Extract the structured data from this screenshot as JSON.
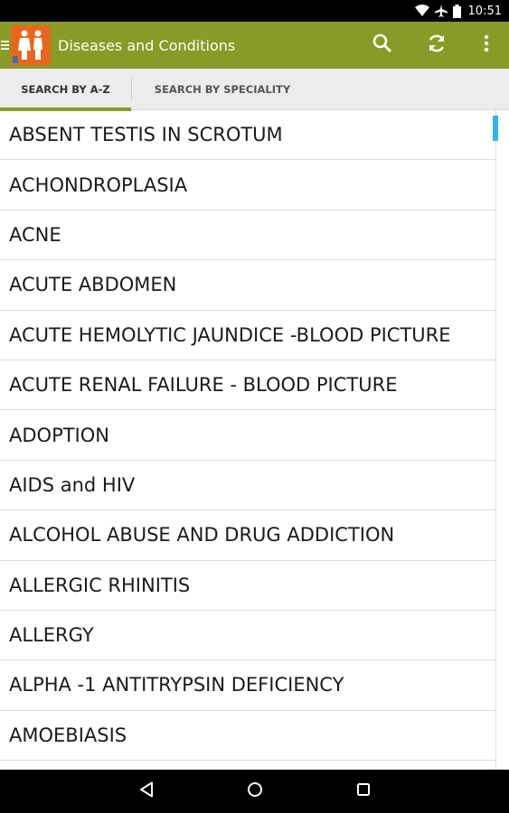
{
  "status_bar": {
    "time": "10:51",
    "icons": [
      "wifi-icon",
      "airplane-icon",
      "battery-icon"
    ]
  },
  "action_bar": {
    "title": "Diseases and Conditions",
    "color": "#8a9a26",
    "actions": [
      "search-icon",
      "refresh-icon",
      "overflow-menu-icon"
    ]
  },
  "tabs": [
    {
      "label": "SEARCH BY A-Z",
      "selected": true
    },
    {
      "label": "SEARCH BY SPECIALITY",
      "selected": false
    }
  ],
  "list": {
    "items": [
      "ABSENT TESTIS IN SCROTUM",
      "ACHONDROPLASIA",
      "ACNE",
      "ACUTE ABDOMEN",
      "ACUTE HEMOLYTIC JAUNDICE -BLOOD PICTURE",
      "ACUTE RENAL FAILURE - BLOOD PICTURE",
      "ADOPTION",
      "AIDS and HIV",
      "ALCOHOL ABUSE AND DRUG ADDICTION",
      "ALLERGIC RHINITIS",
      "ALLERGY",
      "ALPHA -1 ANTITRYPSIN DEFICIENCY",
      "AMOEBIASIS"
    ]
  },
  "nav_bar": {
    "buttons": [
      "back-icon",
      "home-icon",
      "recents-icon"
    ]
  }
}
